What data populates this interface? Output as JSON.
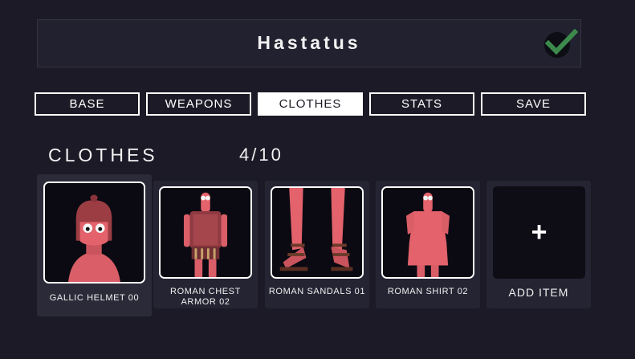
{
  "header": {
    "title": "Hastatus",
    "confirm_icon": "checkmark-icon"
  },
  "tabs": [
    {
      "label": "BASE",
      "active": false
    },
    {
      "label": "WEAPONS",
      "active": false
    },
    {
      "label": "CLOTHES",
      "active": true
    },
    {
      "label": "STATS",
      "active": false
    },
    {
      "label": "SAVE",
      "active": false
    }
  ],
  "section": {
    "title": "CLOTHES",
    "count": "4/10"
  },
  "items": [
    {
      "label": "GALLIC HELMET 00",
      "selected": true
    },
    {
      "label": "ROMAN CHEST ARMOR 02",
      "selected": false
    },
    {
      "label": "ROMAN SANDALS 01",
      "selected": false
    },
    {
      "label": "ROMAN SHIRT 02",
      "selected": false
    }
  ],
  "add_item": {
    "label": "ADD ITEM",
    "icon": "plus-icon"
  },
  "colors": {
    "background": "#1b1a26",
    "panel": "#252433",
    "unit_skin": "#e3626b",
    "check_green": "#3c8a4c"
  }
}
